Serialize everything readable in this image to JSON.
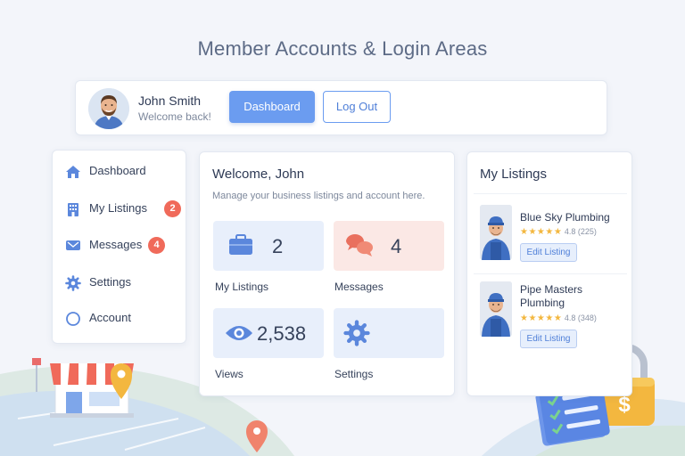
{
  "page": {
    "title": "Member Accounts & Login Areas"
  },
  "header": {
    "user_name": "John Smith",
    "greeting": "Welcome back!",
    "dashboard_label": "Dashboard",
    "logout_label": "Log Out"
  },
  "sidebar": {
    "items": [
      {
        "label": "Dashboard",
        "icon": "home-icon"
      },
      {
        "label": "My Listings",
        "icon": "building-icon",
        "badge": "2"
      },
      {
        "label": "Messages",
        "icon": "message-icon",
        "badge": "4"
      },
      {
        "label": "Settings",
        "icon": "gear-icon"
      },
      {
        "label": "Account",
        "icon": "user-circle-icon"
      }
    ]
  },
  "welcome": {
    "title": "Welcome, John",
    "subtitle": "Manage your business listings and account here.",
    "tiles": [
      {
        "value": "2",
        "caption": "My Listings",
        "icon": "briefcase-icon"
      },
      {
        "value": "4",
        "caption": "Messages",
        "icon": "chat-bubbles-icon"
      },
      {
        "value": "2,538",
        "caption": "Views",
        "icon": "eye-icon"
      },
      {
        "value": "",
        "caption": "Settings",
        "icon": "gear-icon"
      }
    ]
  },
  "listings": {
    "title": "My Listings",
    "items": [
      {
        "name": "Blue Sky Plumbing",
        "stars": "★★★★★",
        "rating": "4.8",
        "reviews": "(225)",
        "edit_label": "Edit Listing"
      },
      {
        "name": "Pipe Masters Plumbing",
        "stars": "★★★★★",
        "rating": "4.8",
        "reviews": "(348)",
        "edit_label": "Edit Listing"
      }
    ]
  },
  "colors": {
    "accent": "#6b9cf0",
    "badge": "#f06a5a",
    "star": "#f3b73f",
    "background": "#f3f5fa"
  }
}
